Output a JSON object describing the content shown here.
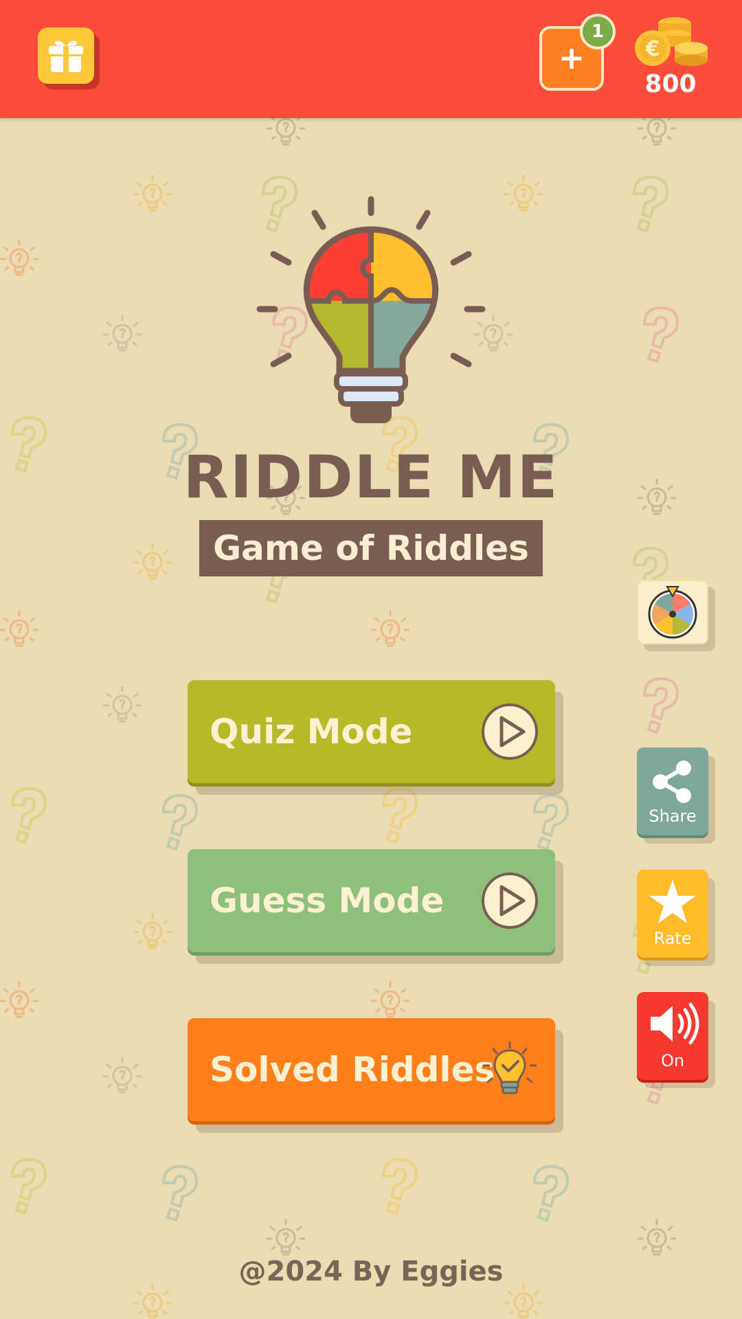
{
  "header": {
    "gift_icon": "gift-icon",
    "add_coins_icon": "plus-icon",
    "notification_count": "1",
    "coins_icon": "coin-stack-icon",
    "coin_count": "800"
  },
  "logo": {
    "bulb_icon": "puzzle-lightbulb-icon",
    "title": "RIDDLE ME",
    "subtitle": "Game of Riddles"
  },
  "menu": {
    "quiz_label": "Quiz Mode",
    "guess_label": "Guess Mode",
    "solved_label": "Solved Riddles"
  },
  "side": {
    "wheel_icon": "spin-wheel-icon",
    "share_label": "Share",
    "rate_label": "Rate",
    "sound_label": "On"
  },
  "footer": {
    "text": "@2024 By Eggies"
  },
  "colors": {
    "header": "#fe4c3a",
    "background": "#ebdcb4",
    "quiz": "#b6b928",
    "guess": "#8ec07c",
    "solved": "#fe7f19",
    "share": "#7fa69b",
    "rate": "#ffbc2a",
    "sound": "#f6382e",
    "title": "#795d52"
  }
}
